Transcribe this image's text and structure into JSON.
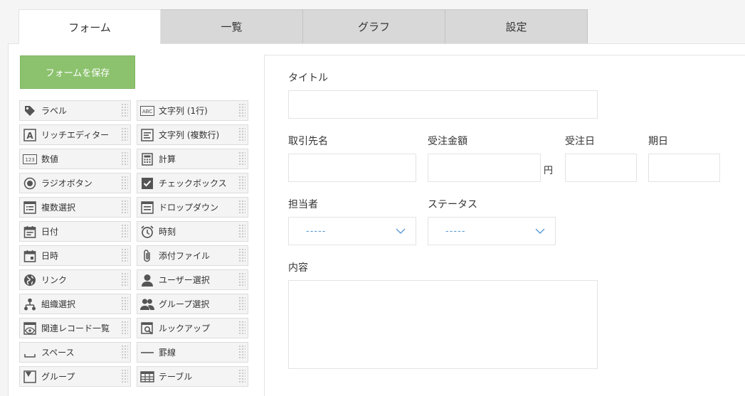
{
  "tabs": [
    {
      "label": "フォーム",
      "active": true
    },
    {
      "label": "一覧",
      "active": false
    },
    {
      "label": "グラフ",
      "active": false
    },
    {
      "label": "設定",
      "active": false
    }
  ],
  "save_button": "フォームを保存",
  "palette": [
    {
      "label": "ラベル",
      "icon": "label-tag-icon"
    },
    {
      "label": "文字列 (1行)",
      "icon": "abc-text-icon"
    },
    {
      "label": "リッチエディター",
      "icon": "rich-editor-icon"
    },
    {
      "label": "文字列 (複数行)",
      "icon": "multiline-text-icon"
    },
    {
      "label": "数値",
      "icon": "number-123-icon"
    },
    {
      "label": "計算",
      "icon": "calculator-icon"
    },
    {
      "label": "ラジオボタン",
      "icon": "radio-button-icon"
    },
    {
      "label": "チェックボックス",
      "icon": "checkbox-icon"
    },
    {
      "label": "複数選択",
      "icon": "multi-select-icon"
    },
    {
      "label": "ドロップダウン",
      "icon": "dropdown-icon"
    },
    {
      "label": "日付",
      "icon": "calendar-icon"
    },
    {
      "label": "時刻",
      "icon": "alarm-clock-icon"
    },
    {
      "label": "日時",
      "icon": "datetime-icon"
    },
    {
      "label": "添付ファイル",
      "icon": "paperclip-icon"
    },
    {
      "label": "リンク",
      "icon": "globe-link-icon"
    },
    {
      "label": "ユーザー選択",
      "icon": "user-icon"
    },
    {
      "label": "組織選択",
      "icon": "org-chart-icon"
    },
    {
      "label": "グループ選択",
      "icon": "group-icon"
    },
    {
      "label": "関連レコード一覧",
      "icon": "related-records-icon"
    },
    {
      "label": "ルックアップ",
      "icon": "lookup-icon"
    },
    {
      "label": "スペース",
      "icon": "space-icon"
    },
    {
      "label": "罫線",
      "icon": "horizontal-rule-icon"
    },
    {
      "label": "グループ",
      "icon": "group-folder-icon"
    },
    {
      "label": "テーブル",
      "icon": "table-icon"
    }
  ],
  "form": {
    "title_label": "タイトル",
    "client_label": "取引先名",
    "amount_label": "受注金額",
    "amount_unit": "円",
    "order_date_label": "受注日",
    "due_date_label": "期日",
    "owner_label": "担当者",
    "owner_placeholder": "-----",
    "status_label": "ステータス",
    "status_placeholder": "-----",
    "content_label": "内容"
  },
  "colors": {
    "save_button": "#8cc26e",
    "select_placeholder": "#5b9bd5",
    "tab_inactive": "#d8d8d8"
  }
}
